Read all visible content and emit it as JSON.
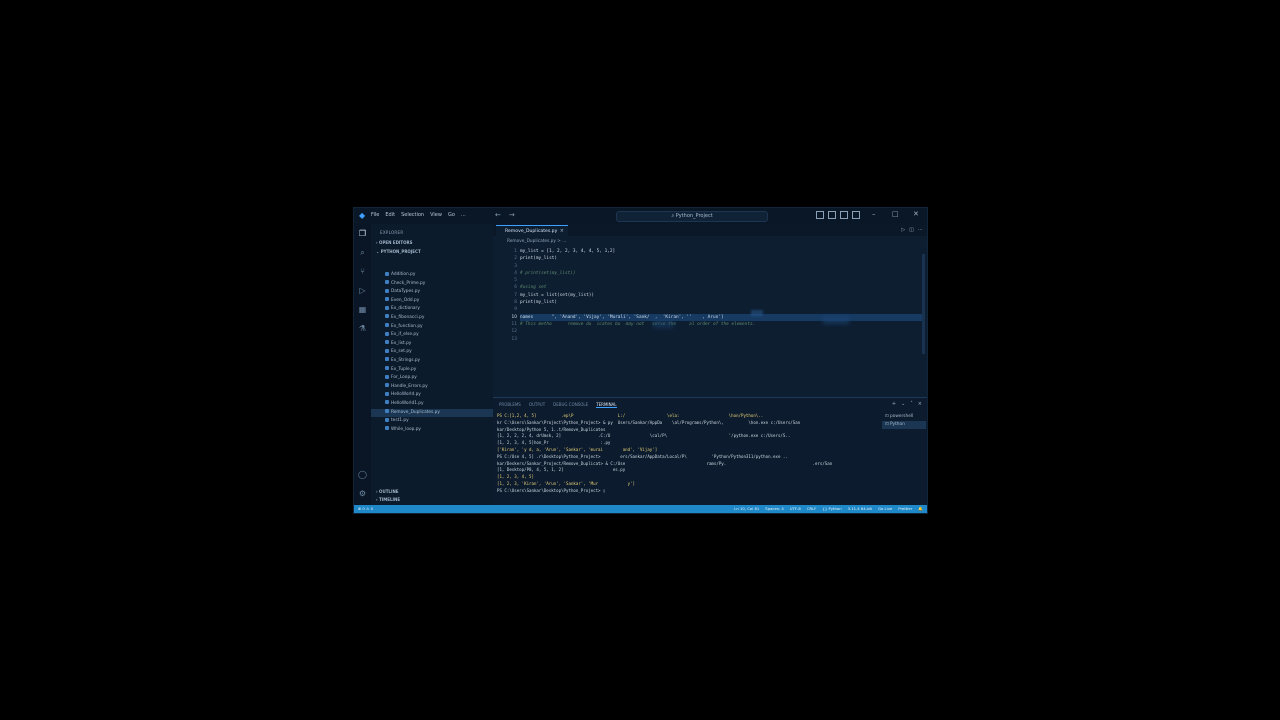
{
  "title_bar": {
    "menu": [
      "File",
      "Edit",
      "Selection",
      "View",
      "Go",
      "..."
    ],
    "search": "Python_Project",
    "controls": {
      "minimize": "–",
      "maximize": "□",
      "close": "✕"
    }
  },
  "sidebar": {
    "title": "EXPLORER",
    "open_editors": "OPEN EDITORS",
    "project": "PYTHON_PROJECT",
    "files": [
      "Addition.py",
      "Check_Prime.py",
      "DataTypes.py",
      "Even_Odd.py",
      "Ex_dictionary",
      "Ex_fibonacci.py",
      "Ex_function.py",
      "Ex_if_else.py",
      "Ex_list.py",
      "Ex_set.py",
      "Ex_Strings.py",
      "Ex_Tuple.py",
      "For_Loop.py",
      "Handle_Errors.py",
      "HelloWorld.py",
      "HelloWorld1.py",
      "Remove_Duplicates.py",
      "test1.py",
      "While_loop.py"
    ],
    "selected_index": 16,
    "outline": "OUTLINE",
    "timeline": "TIMELINE"
  },
  "editor": {
    "tab": "Remove_Duplicates.py",
    "breadcrumb": "Remove_Duplicates.py > ...",
    "line_numbers": [
      "1",
      "2",
      "3",
      "4",
      "5",
      "6",
      "7",
      "8",
      "9",
      "10",
      "11",
      "12",
      "13"
    ],
    "current_line": 10,
    "lines": [
      {
        "t": "my_list = [1, 2, 2, 3, 4, 4, 5, 1,2]",
        "c": ""
      },
      {
        "t": "print(my_list)",
        "c": ""
      },
      {
        "t": "",
        "c": ""
      },
      {
        "t": "# print(set(my_list))",
        "c": "cm"
      },
      {
        "t": "",
        "c": ""
      },
      {
        "t": "#using set",
        "c": "cm"
      },
      {
        "t": "my_list = list(set(my_list))",
        "c": ""
      },
      {
        "t": "print(my_list)",
        "c": ""
      },
      {
        "t": "",
        "c": ""
      },
      {
        "t": "names       \", 'Anand', 'Vijay', 'Murali', 'Sank/  ,  'Kiran', ''    , Arun']",
        "c": "hl"
      },
      {
        "t": "# This metho      remove du  icates bu  may not   serve the     al order of the elements.",
        "c": "cm"
      },
      {
        "t": "",
        "c": ""
      },
      {
        "t": "",
        "c": ""
      }
    ]
  },
  "panel": {
    "tabs": [
      "PROBLEMS",
      "OUTPUT",
      "DEBUG CONSOLE",
      "TERMINAL"
    ],
    "active_tab": 3,
    "terminal_lines": [
      {
        "t": "PS C:[1,2, 4, 5]          .ep\\P                  L:/                 \\ela:                    \\hon/Python\\..",
        "c": "y"
      },
      {
        "t": "kr C:\\Users\\Sankar\\Project\\Python_Project> & py  Users/Sankar/AppDa    \\al/Programs/Python\\,          \\hon.exe c:/Users/San",
        "c": ""
      },
      {
        "t": "kar/Desktop/Python 5, 1..t/Remove_Duplicates",
        "c": ""
      },
      {
        "t": "[1, 2, 2, 2, 4, drUmsk, 2]               .C:/U                \\cal/P\\                         '/python.exe c:/Users/S..",
        "c": ""
      },
      {
        "t": "[1, 2, 3, 4, 5]hon_Pr                     :.py",
        "c": ""
      },
      {
        "t": "['Kiran', 'y d, a, 'Arun', 'Sankar', 'murai        and', 'Vijay']",
        "c": "y"
      },
      {
        "t": "PS C:/Use 4, 5] .r\\Desktop\\Python_Project>        ers/Sankar/AppData/Local/P\\          'Python/Python311/python.exe ..",
        "c": ""
      },
      {
        "t": "kar/Deskers/Sankar_Project/Remove_Duplicat> & C:/Use                                 rams/Py.                                   .ers/San",
        "c": ""
      },
      {
        "t": "[1, Desktop/P8, 4, 5, 1, 2]                    es.py",
        "c": ""
      },
      {
        "t": "[1, 2, 3, 4, 5]",
        "c": "y"
      },
      {
        "t": "[1, 2, 3, 'Kiran', 'Arun', 'Sankar', 'Mur            y']",
        "c": "y"
      },
      {
        "t": "PS C:\\Users\\Sankar\\Desktop\\Python_Project> ▯",
        "c": ""
      }
    ],
    "terminals": [
      "powershell",
      "Python"
    ]
  },
  "status": {
    "left": "⊗ 0  ⚠ 0",
    "right": [
      "Ln 10, Col 81",
      "Spaces: 4",
      "UTF-8",
      "CRLF",
      "{} Python",
      "3.11.4 64-bit",
      "Go Live",
      "Prettier",
      "🔔"
    ]
  },
  "colors": {
    "accent": "#3ea0ff",
    "statusbar": "#1e88c8",
    "background": "#0b1a2b"
  }
}
